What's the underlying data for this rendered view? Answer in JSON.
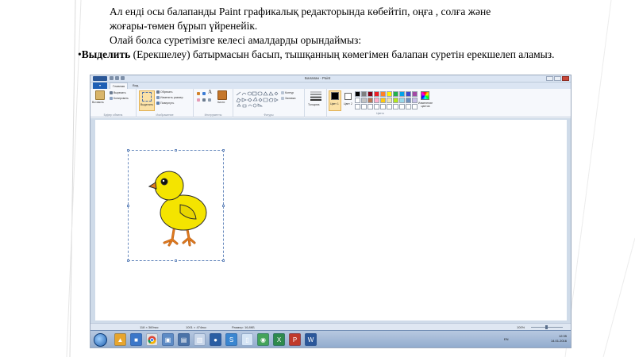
{
  "slide": {
    "line1": "Ал енді осы балапанды Paint графикалық редакторында көбейтіп, оңға , солға және",
    "line2": "жоғары-төмен бұрып үйренейік.",
    "line3": "Олай болса суретімізге келесі амалдарды орындаймыз:",
    "bullet_symbol": "•",
    "bullet_bold": "Выделить",
    "bullet_rest": " (Ерекшелеу) батырмасын басып, тышқанның көмегімен балапан суретін ерекшелеп аламыз."
  },
  "paint": {
    "window_title": "Балапан - Paint",
    "tabs": [
      "Главная",
      "Вид"
    ],
    "ribbon": {
      "clipboard": {
        "paste": "Вставить",
        "cut": "Вырезать",
        "copy": "Копировать",
        "label": "Буфер обмена"
      },
      "image": {
        "select": "Выделить",
        "crop": "Обрезать",
        "resize": "Изменить размер",
        "rotate": "Повернуть",
        "label": "Изображение"
      },
      "tools": {
        "label": "Инструменты",
        "brushes": "Кисти"
      },
      "shapes": {
        "outline": "Контур",
        "fill": "Заливка",
        "label": "Фигуры"
      },
      "size": "Толщина",
      "color1": "Цвет 1",
      "color2": "Цвет 2",
      "edit_colors": "Изменение цветов",
      "colors_label": "Цвета"
    },
    "palette": [
      "#000000",
      "#7f7f7f",
      "#880015",
      "#ed1c24",
      "#ff7f27",
      "#fff200",
      "#22b14c",
      "#00a2e8",
      "#3f48cc",
      "#a349a4",
      "#ffffff",
      "#c3c3c3",
      "#b97a57",
      "#ffaec9",
      "#ffc90e",
      "#efe4b0",
      "#b5e61d",
      "#99d9ea",
      "#7092be",
      "#c8bfe7",
      "#ffffff",
      "#ffffff",
      "#ffffff",
      "#ffffff",
      "#ffffff",
      "#ffffff",
      "#ffffff",
      "#ffffff",
      "#ffffff",
      "#ffffff"
    ],
    "status": {
      "position": "118 × 369пкс",
      "selection_size": "1001 × 474пкс",
      "file_size": "Размер: 16,8КБ",
      "zoom": "100%"
    }
  },
  "taskbar": {
    "lang": "EN",
    "time": "12:35",
    "date": "14.01.2016"
  },
  "colors": {
    "accent": "#1e5fb5",
    "chick_body": "#f4e400",
    "chick_feet": "#e07a1f"
  }
}
